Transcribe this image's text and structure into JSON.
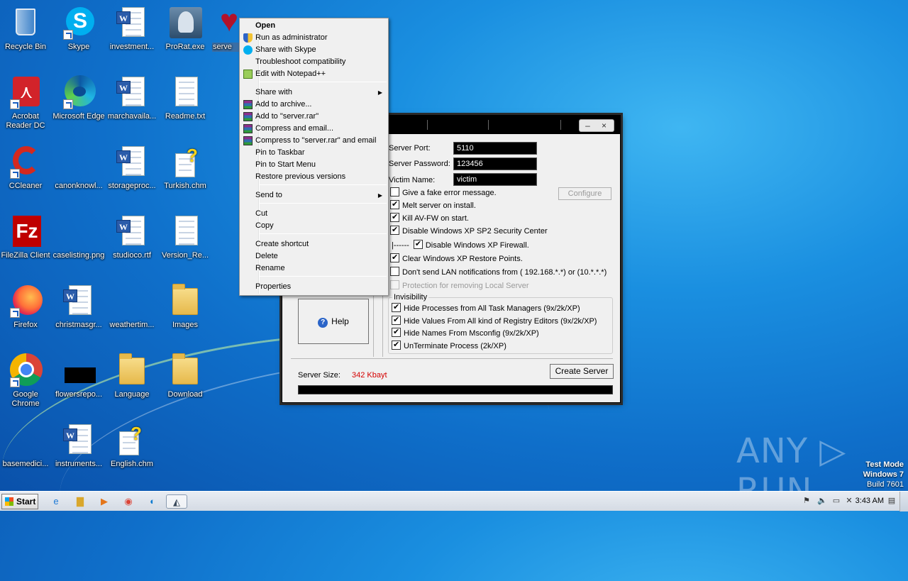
{
  "desktop": {
    "icons": [
      {
        "label": "Recycle Bin"
      },
      {
        "label": "Skype"
      },
      {
        "label": "investment..."
      },
      {
        "label": "ProRat.exe"
      },
      {
        "label": "serve"
      },
      {
        "label": "Acrobat Reader DC"
      },
      {
        "label": "Microsoft Edge"
      },
      {
        "label": "marchavaila..."
      },
      {
        "label": "Readme.txt"
      },
      {
        "label": "CCleaner"
      },
      {
        "label": "canonknowl..."
      },
      {
        "label": "storageproc..."
      },
      {
        "label": "Turkish.chm"
      },
      {
        "label": "FileZilla Client"
      },
      {
        "label": "caselisting.png"
      },
      {
        "label": "studioco.rtf"
      },
      {
        "label": "Version_Re..."
      },
      {
        "label": "Firefox"
      },
      {
        "label": "christmasgr..."
      },
      {
        "label": "weathertim..."
      },
      {
        "label": "Images"
      },
      {
        "label": "Google Chrome"
      },
      {
        "label": "flowersrepo..."
      },
      {
        "label": "Language"
      },
      {
        "label": "Download"
      },
      {
        "label": "basemedici..."
      },
      {
        "label": "instruments..."
      },
      {
        "label": "English.chm"
      }
    ]
  },
  "context_menu": {
    "items": [
      {
        "label": "Open",
        "icon": "none"
      },
      {
        "label": "Run as administrator",
        "icon": "shield-icon"
      },
      {
        "label": "Share with Skype",
        "icon": "skype-icon"
      },
      {
        "label": "Troubleshoot compatibility",
        "icon": "none"
      },
      {
        "label": "Edit with Notepad++",
        "icon": "notepadpp-icon"
      },
      {
        "label": "Share with",
        "icon": "none"
      },
      {
        "label": "Add to archive...",
        "icon": "winrar-icon"
      },
      {
        "label": "Add to \"server.rar\"",
        "icon": "winrar-icon"
      },
      {
        "label": "Compress and email...",
        "icon": "winrar-icon"
      },
      {
        "label": "Compress to \"server.rar\" and email",
        "icon": "winrar-icon"
      },
      {
        "label": "Pin to Taskbar",
        "icon": "none"
      },
      {
        "label": "Pin to Start Menu",
        "icon": "none"
      },
      {
        "label": "Restore previous versions",
        "icon": "none"
      },
      {
        "label": "Send to",
        "icon": "none"
      },
      {
        "label": "Cut",
        "icon": "none"
      },
      {
        "label": "Copy",
        "icon": "none"
      },
      {
        "label": "Create shortcut",
        "icon": "none"
      },
      {
        "label": "Delete",
        "icon": "none"
      },
      {
        "label": "Rename",
        "icon": "none"
      },
      {
        "label": "Properties",
        "icon": "none"
      }
    ]
  },
  "prorat": {
    "server_port_label": "Server Port:",
    "server_port_value": "5110",
    "server_password_label": "Server Password:",
    "server_password_value": "123456",
    "victim_name_label": "Victim Name:",
    "victim_name_value": "victim",
    "configure_label": "Configure",
    "options": [
      {
        "label": "Give a fake error message.",
        "checked": false
      },
      {
        "label": "Melt server on install.",
        "checked": true
      },
      {
        "label": "Kill AV-FW on start.",
        "checked": true
      },
      {
        "label": "Disable Windows XP SP2 Security Center",
        "checked": true
      },
      {
        "label": "Disable Windows XP Firewall.",
        "checked": true
      },
      {
        "label": "Clear Windows XP Restore Points.",
        "checked": true
      },
      {
        "label": "Don't send LAN notifications from ( 192.168.*.*) or (10.*.*.*)",
        "checked": false
      },
      {
        "label": "Protection for removing Local Server",
        "checked": false
      }
    ],
    "firewall_prefix": "|------",
    "invisibility_title": "Invisibility",
    "invisibility": [
      {
        "label": "Hide Processes from All Task Managers  (9x/2k/XP)",
        "checked": true
      },
      {
        "label": "Hide Values From All kind of Registry Editors (9x/2k/XP)",
        "checked": true
      },
      {
        "label": "Hide Names From Msconfig  (9x/2k/XP)",
        "checked": true
      },
      {
        "label": "UnTerminate Process (2k/XP)",
        "checked": true
      }
    ],
    "help_label": "Help",
    "server_size_label": "Server Size:",
    "server_size_value": "342 Kbayt",
    "create_server_label": "Create Server"
  },
  "taskbar": {
    "start_label": "Start",
    "clock": "3:43 AM"
  },
  "watermark": {
    "brand": "ANY ▷ RUN",
    "test_mode": "Test Mode",
    "os": "Windows 7",
    "build": "Build 7601"
  },
  "colors": {
    "server_size_value": "#d40000",
    "desktop_background": "#1a8fe0"
  }
}
